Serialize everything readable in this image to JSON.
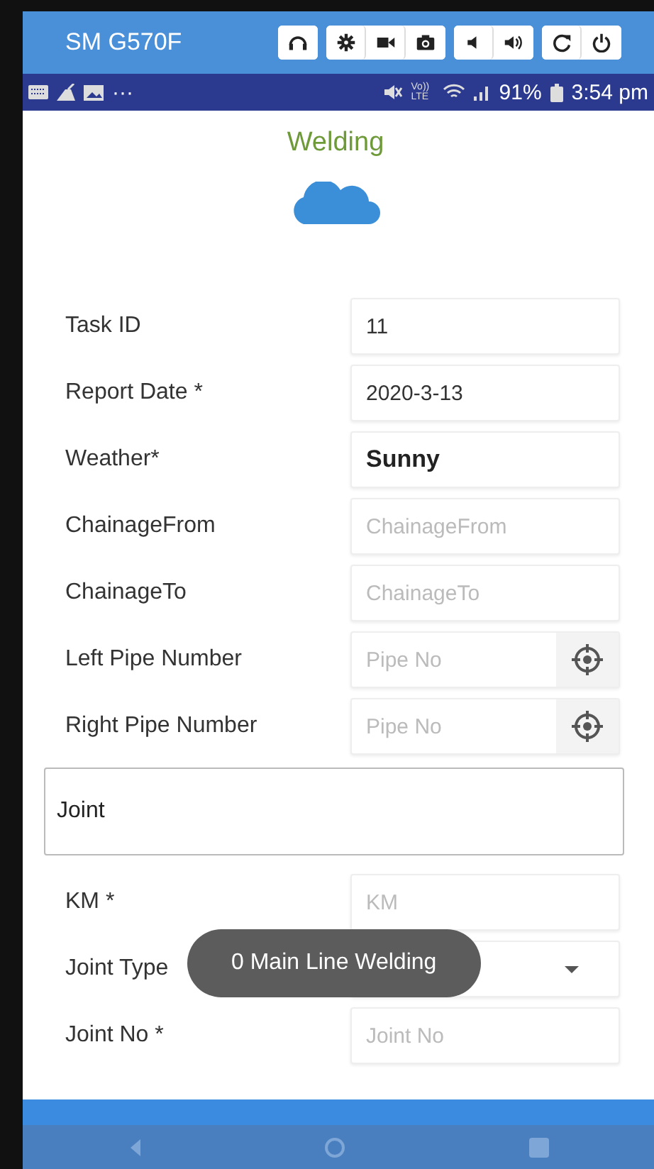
{
  "device": {
    "name": "SM G570F"
  },
  "status_bar": {
    "overflow": "···",
    "network": "Vo)) LTE",
    "battery": "91%",
    "time": "3:54 pm"
  },
  "header": {
    "title": "Welding"
  },
  "fields": [
    {
      "kind": "value",
      "label": "Task ID",
      "value": "11"
    },
    {
      "kind": "value",
      "label": "Report Date *",
      "value": "2020-3-13"
    },
    {
      "kind": "choice",
      "label": "Weather*",
      "value": "Sunny"
    },
    {
      "kind": "text",
      "label": "ChainageFrom",
      "placeholder": "ChainageFrom"
    },
    {
      "kind": "text",
      "label": "ChainageTo",
      "placeholder": "ChainageTo"
    },
    {
      "kind": "picker",
      "label": "Left Pipe Number",
      "placeholder": "Pipe No"
    },
    {
      "kind": "picker",
      "label": "Right Pipe Number",
      "placeholder": "Pipe No"
    },
    {
      "kind": "section",
      "label": "Joint"
    },
    {
      "kind": "text",
      "label": "KM *",
      "placeholder": "KM"
    },
    {
      "kind": "dropdown",
      "label": "Joint Type"
    },
    {
      "kind": "text",
      "label": "Joint No *",
      "placeholder": "Joint No"
    }
  ],
  "toast": {
    "text": "0 Main Line Welding"
  }
}
